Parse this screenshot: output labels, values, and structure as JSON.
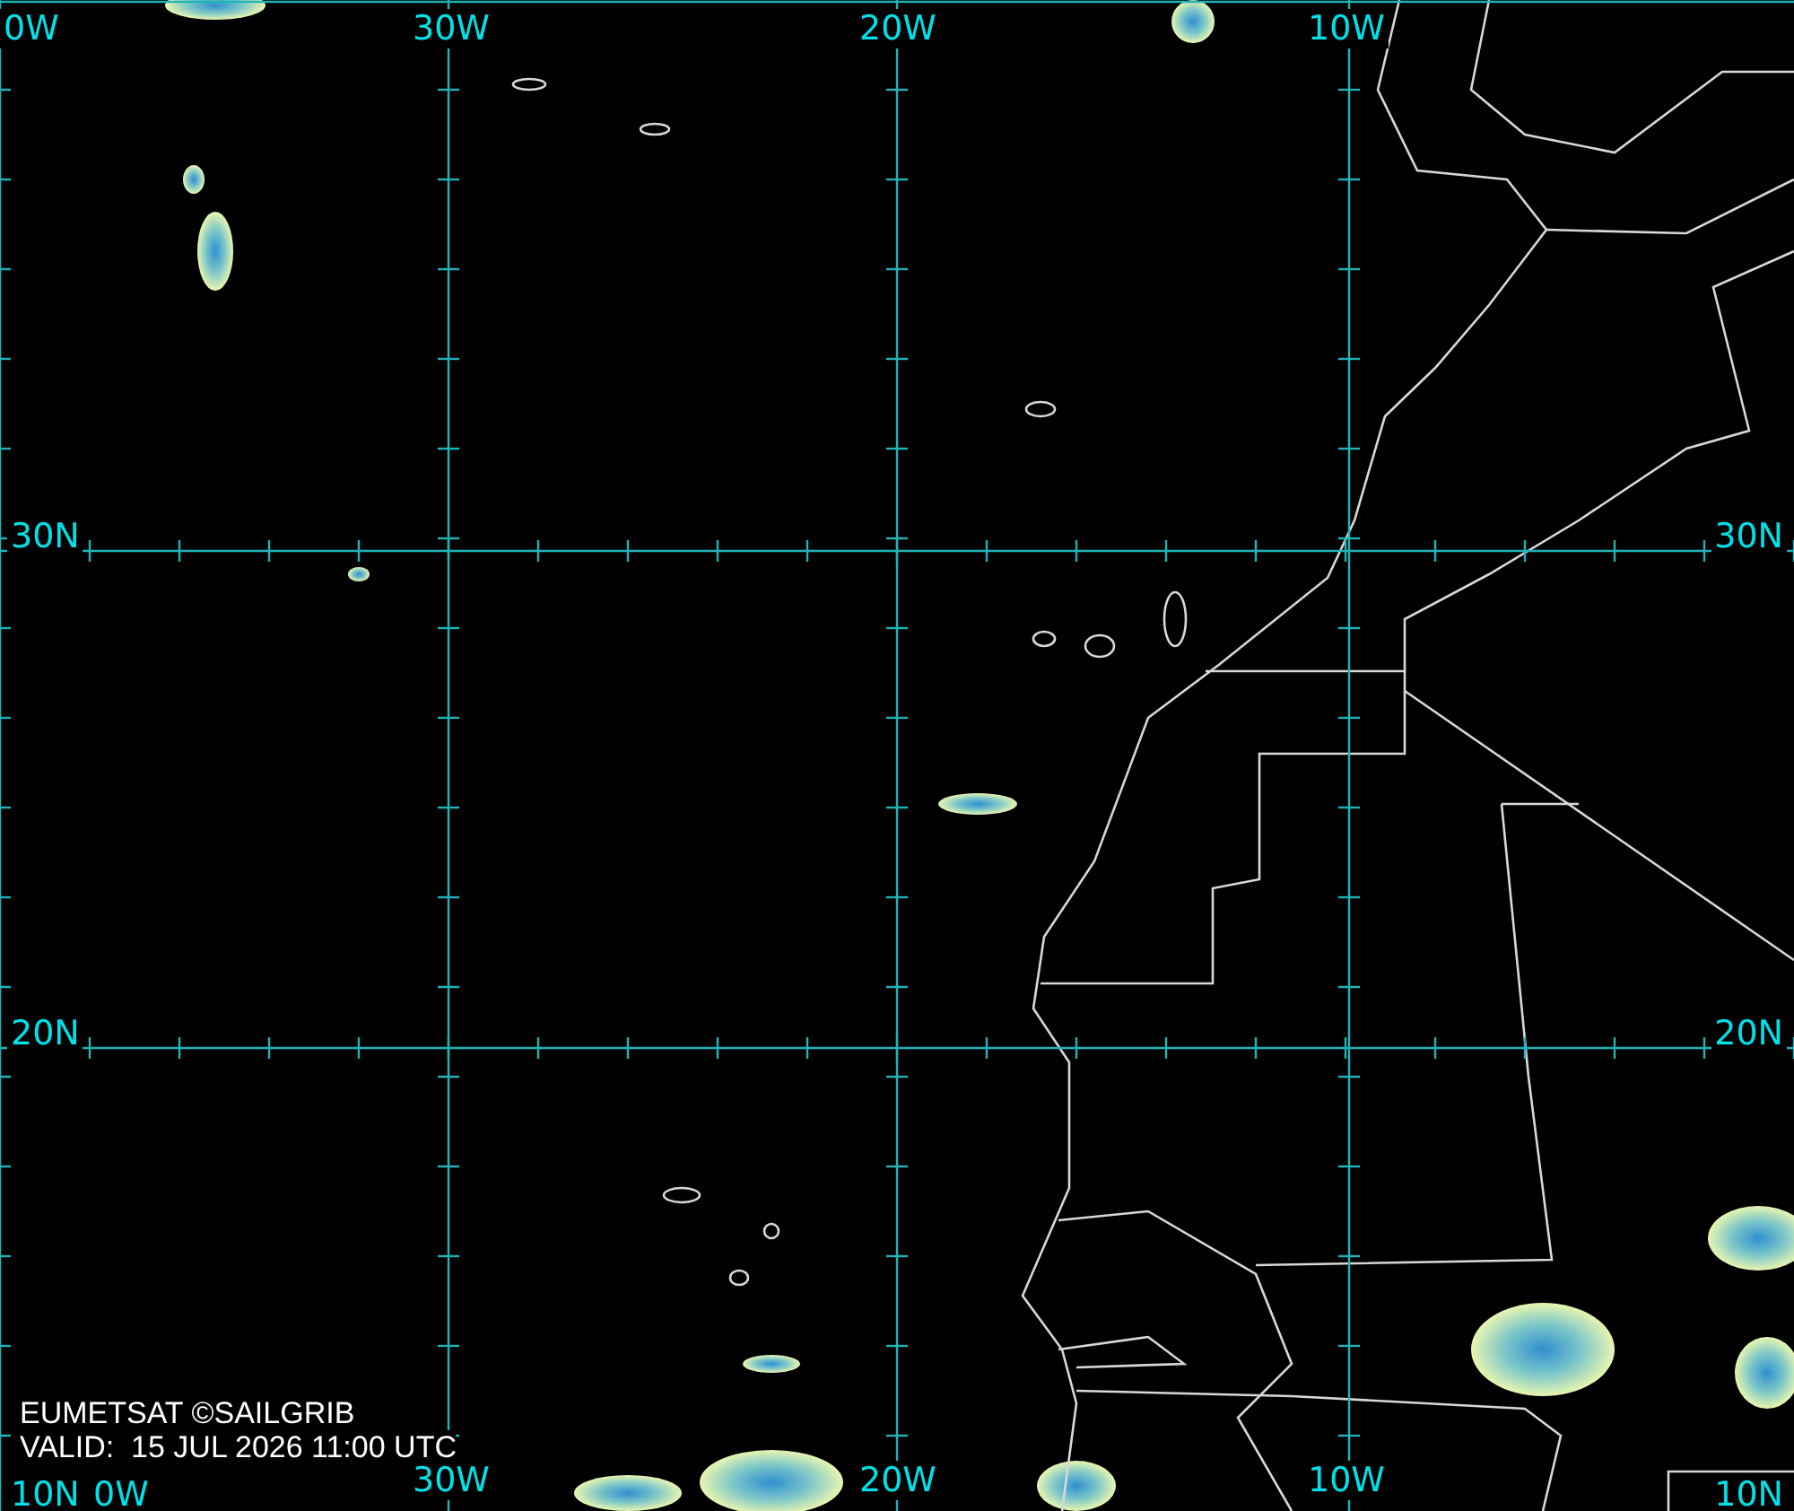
{
  "map": {
    "top_labels": [
      "0W",
      "30W",
      "20W",
      "10W"
    ],
    "bottom_labels": [
      "30W",
      "20W",
      "10W"
    ],
    "left_labels": [
      "30N",
      "20N",
      "10N"
    ],
    "right_labels": [
      "30N",
      "20N",
      "10N"
    ],
    "corner_label": "0W"
  },
  "caption": {
    "source": "EUMETSAT ©SAILGRIB",
    "valid": "VALID:  15 JUL 2026 11:00 UTC"
  }
}
